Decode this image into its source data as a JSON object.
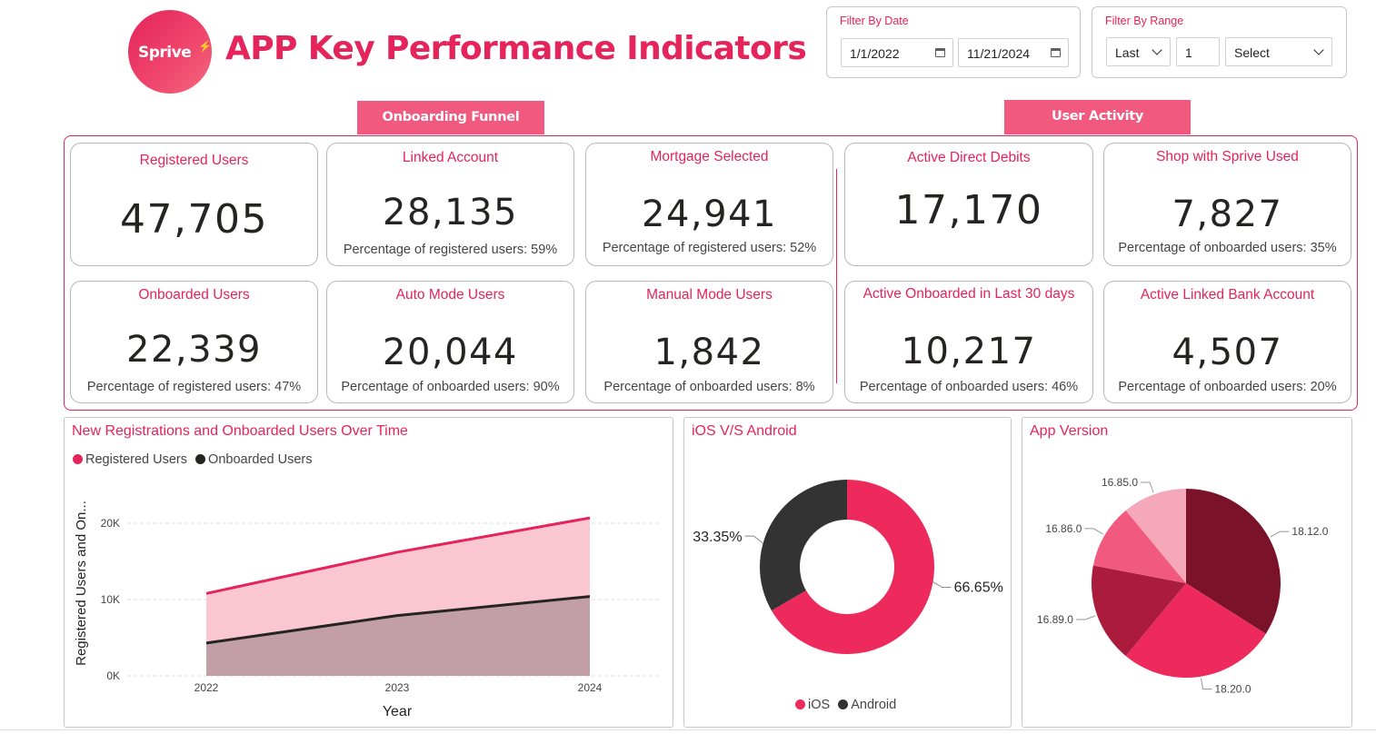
{
  "header": {
    "logo_text": "Sprive",
    "title": "APP Key Performance Indicators"
  },
  "filters": {
    "date": {
      "label": "Filter By Date",
      "start": "1/1/2022",
      "end": "11/21/2024"
    },
    "range": {
      "label": "Filter By Range",
      "period": "Last",
      "count": "1",
      "unit": "Select"
    }
  },
  "sections": {
    "onboarding": "Onboarding Funnel",
    "activity": "User Activity"
  },
  "kpis": {
    "registered_users": {
      "title": "Registered Users",
      "value": "47,705"
    },
    "linked_account": {
      "title": "Linked Account",
      "value": "28,135",
      "sub": "Percentage of registered users: 59%"
    },
    "mortgage_selected": {
      "title": "Mortgage Selected",
      "value": "24,941",
      "sub": "Percentage of registered users: 52%"
    },
    "onboarded_users": {
      "title": "Onboarded Users",
      "value": "22,339",
      "sub": "Percentage of registered users: 47%"
    },
    "auto_mode_users": {
      "title": "Auto Mode Users",
      "value": "20,044",
      "sub": "Percentage of onboarded users: 90%"
    },
    "manual_mode_users": {
      "title": "Manual Mode Users",
      "value": "1,842",
      "sub": "Percentage of onboarded users: 8%"
    },
    "active_direct_debits": {
      "title": "Active Direct Debits",
      "value": "17,170"
    },
    "shop_with_sprive": {
      "title": "Shop with Sprive Used",
      "value": "7,827",
      "sub": "Percentage of onboarded users: 35%"
    },
    "active_onboarded_30": {
      "title": "Active Onboarded in Last 30 days",
      "value": "10,217",
      "sub": "Percentage of onboarded users: 46%"
    },
    "active_linked_bank": {
      "title": "Active Linked Bank Account",
      "value": "4,507",
      "sub": "Percentage of onboarded users: 20%"
    }
  },
  "colors": {
    "accent": "#e4245a",
    "registered_line": "#e4245a",
    "registered_fill": "#f9c6d2",
    "onboarded_line": "#252423",
    "onboarded_fill": "#c29fa6",
    "ios": "#ee2a5c",
    "android": "#333333"
  },
  "chart_data": [
    {
      "type": "area",
      "title": "New Registrations and Onboarded Users Over Time",
      "xlabel": "Year",
      "ylabel": "Registered Users and On...",
      "x": [
        "2022",
        "2023",
        "2024"
      ],
      "series": [
        {
          "name": "Registered Users",
          "values": [
            10800,
            16200,
            20700
          ]
        },
        {
          "name": "Onboarded Users",
          "values": [
            4300,
            7900,
            10400
          ]
        }
      ],
      "ylim": [
        0,
        20000
      ],
      "yticks": [
        {
          "value": 20000,
          "label": "20K"
        },
        {
          "value": 10000,
          "label": "10K"
        },
        {
          "value": 0,
          "label": "0K"
        }
      ],
      "legend_position": "top-left",
      "grid": true
    },
    {
      "type": "pie",
      "title": "iOS V/S Android",
      "donut": true,
      "labels": [
        "iOS",
        "Android"
      ],
      "values": [
        66.65,
        33.35
      ],
      "data_labels": [
        "66.65%",
        "33.35%"
      ],
      "legend_position": "bottom"
    },
    {
      "type": "pie",
      "title": "App Version",
      "labels": [
        "18.12.0",
        "18.20.0",
        "16.89.0",
        "16.86.0",
        "16.85.0"
      ],
      "values": [
        34,
        27,
        17,
        11,
        11
      ],
      "colors": [
        "#7a1329",
        "#ee2a5c",
        "#aa1b3c",
        "#f15a7e",
        "#f6a8bb"
      ]
    }
  ]
}
